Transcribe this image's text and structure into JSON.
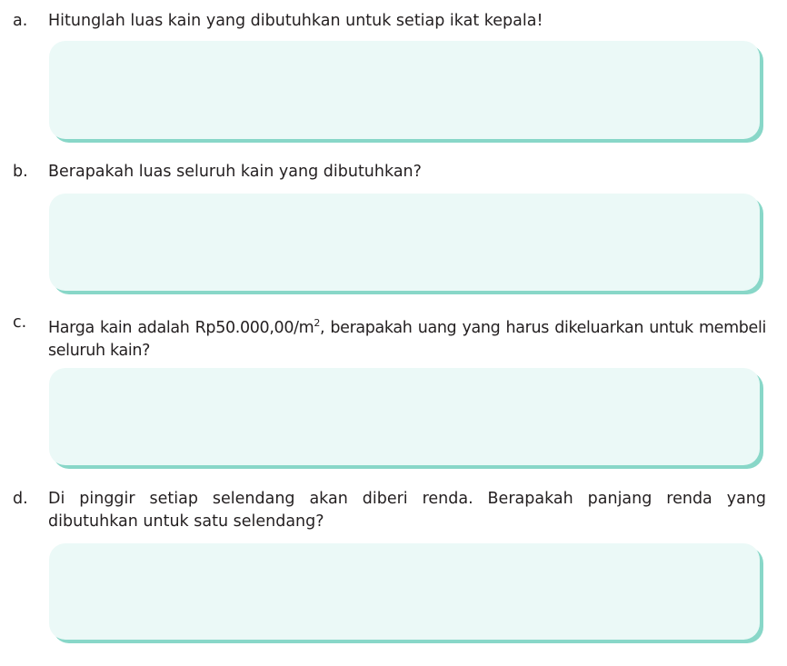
{
  "questions": [
    {
      "letter": "a.",
      "text": "Hitunglah luas kain yang dibutuhkan untuk setiap ikat kepala!"
    },
    {
      "letter": "b.",
      "text": "Berapakah luas seluruh kain yang dibutuhkan?"
    },
    {
      "letter": "c.",
      "text_before_sup": "Harga kain adalah Rp50.000,00/m",
      "sup": "2",
      "text_after_sup": ", berapakah uang yang harus dikeluarkan untuk membeli seluruh kain?"
    },
    {
      "letter": "d.",
      "text": "Di pinggir setiap selendang akan diberi renda. Berapakah panjang renda yang dibutuhkan untuk satu selendang?"
    }
  ],
  "colors": {
    "answer_box_fill": "#ebf9f7",
    "answer_box_shadow": "#88d7c8",
    "text": "#231f20"
  }
}
